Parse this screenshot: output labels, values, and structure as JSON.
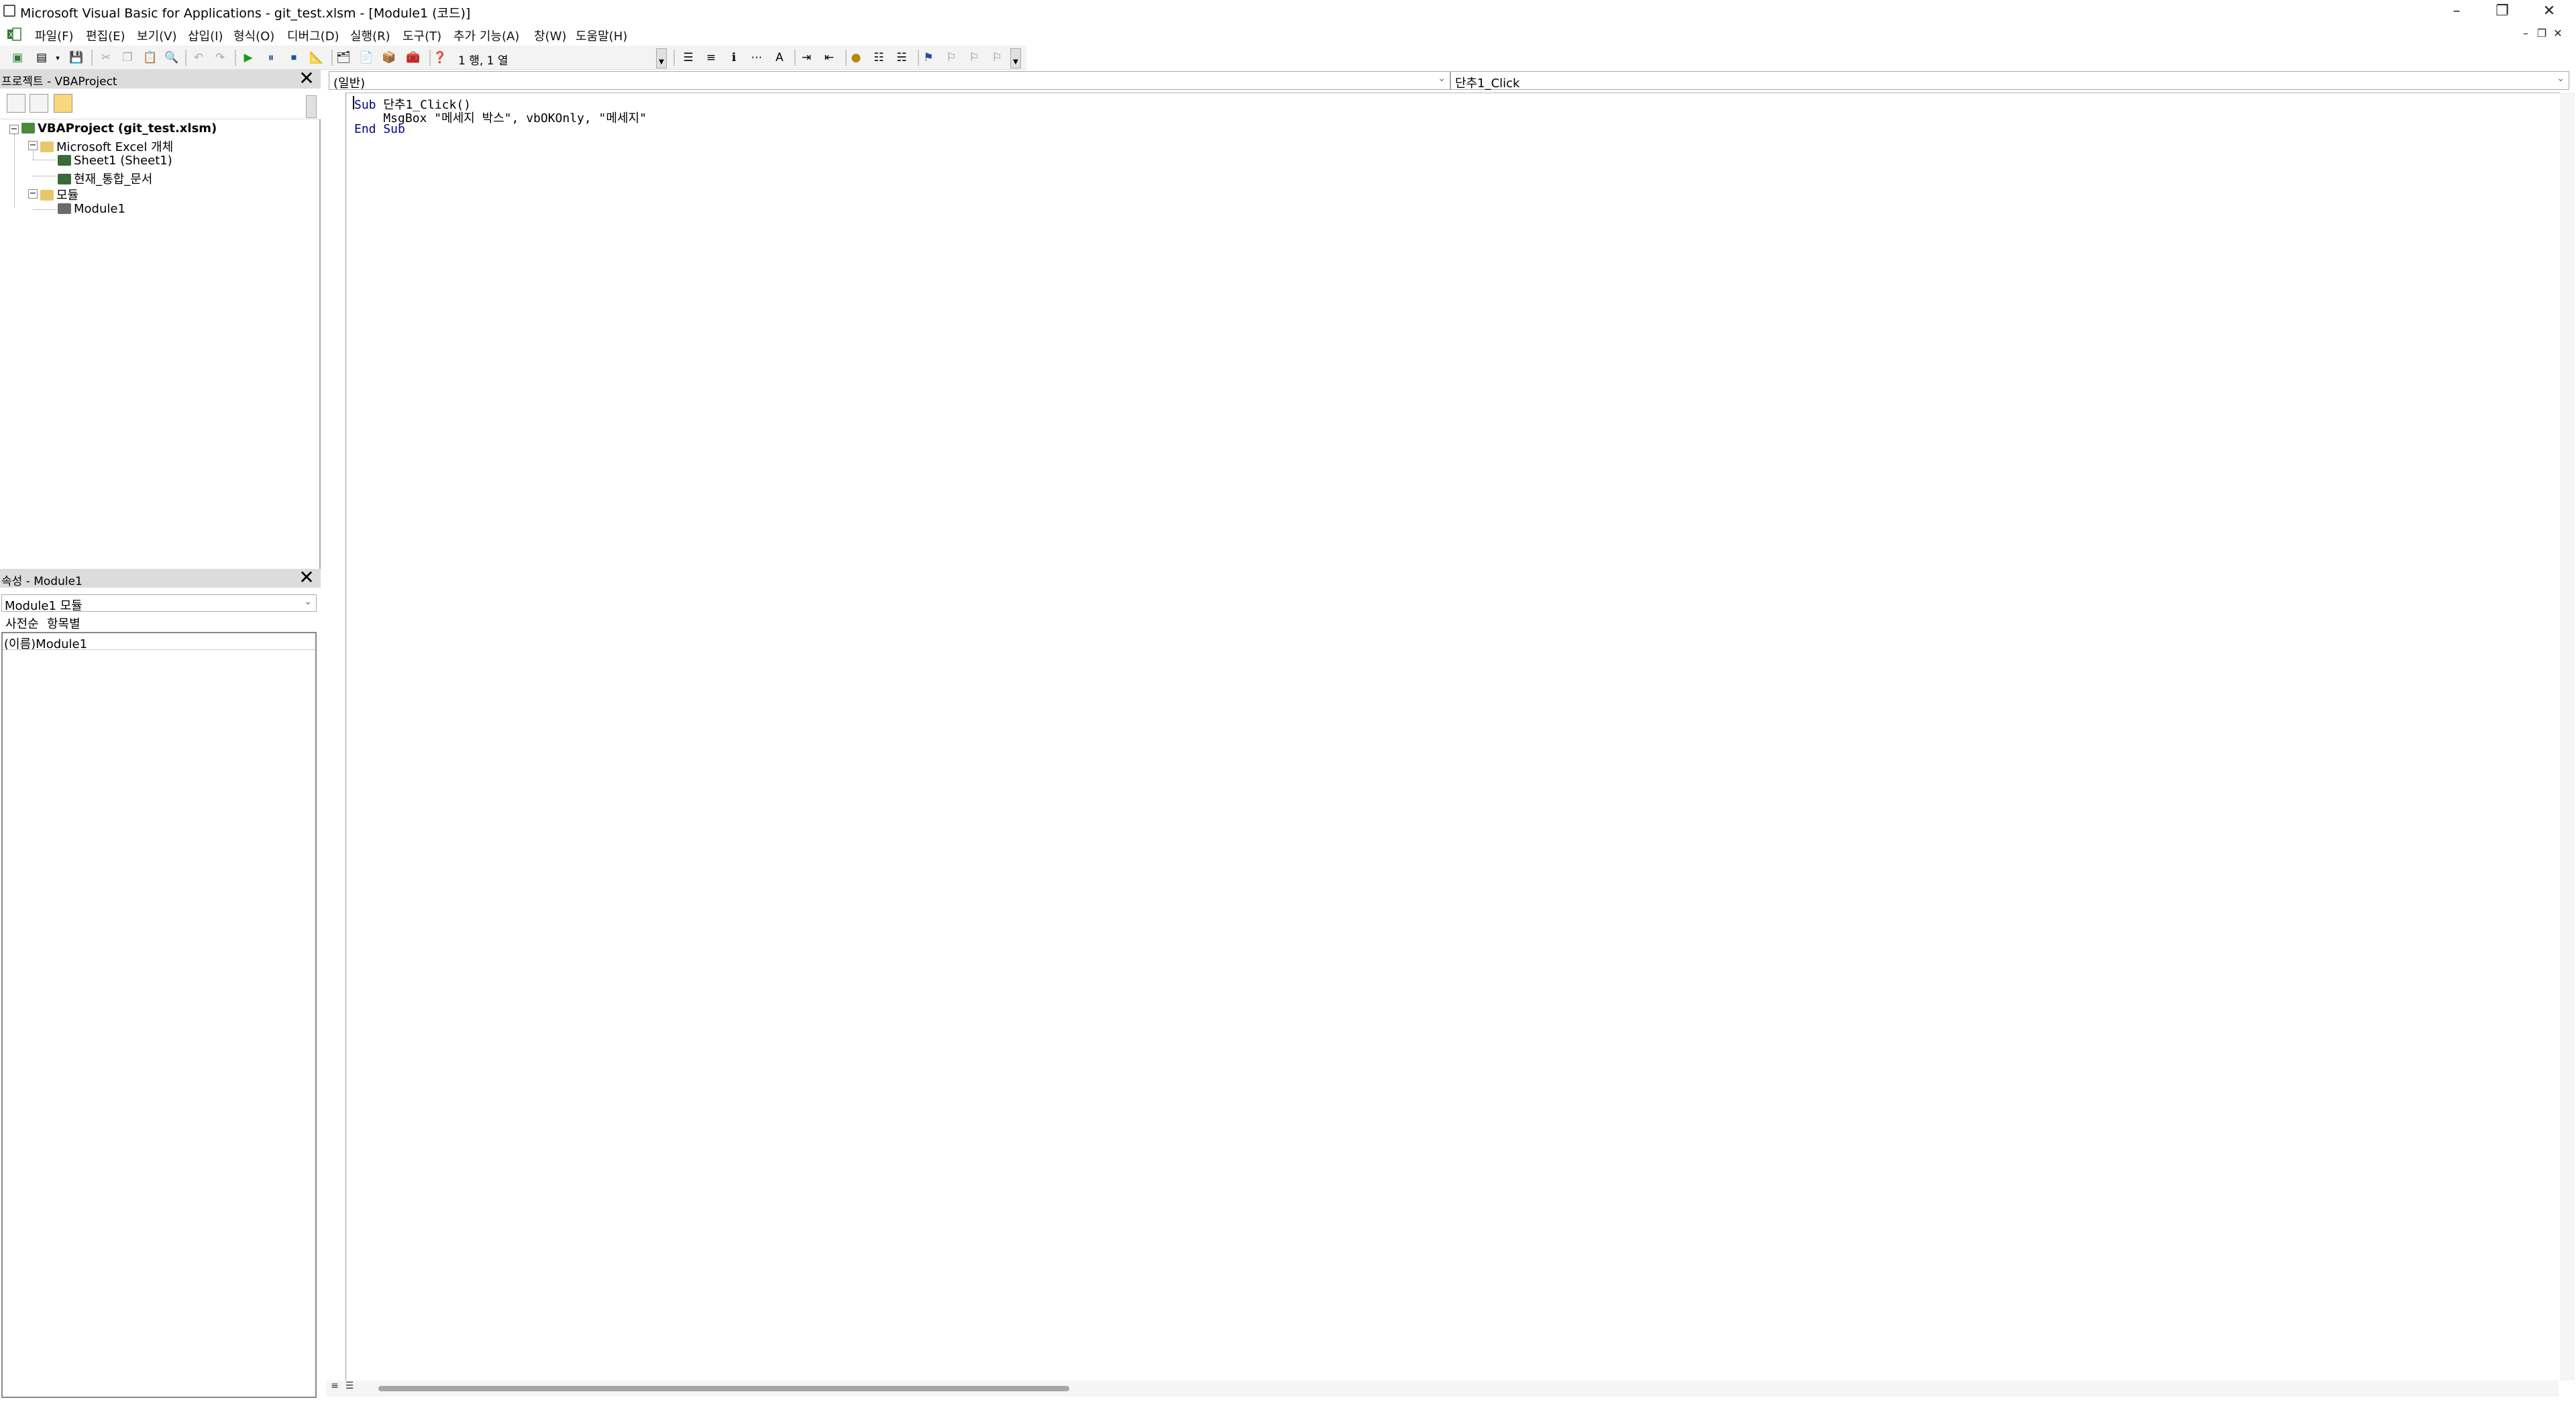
{
  "window": {
    "title": "Microsoft Visual Basic for Applications - git_test.xlsm - [Module1 (코드)]",
    "controls": [
      "–",
      "❐",
      "✕"
    ],
    "mdi_controls": [
      "–",
      "❐",
      "✕"
    ]
  },
  "menu": {
    "items": [
      "파일(F)",
      "편집(E)",
      "보기(V)",
      "삽입(I)",
      "형식(O)",
      "디버그(D)",
      "실행(R)",
      "도구(T)",
      "추가 기능(A)",
      "창(W)",
      "도움말(H)"
    ]
  },
  "toolbar": {
    "position": "1 행, 1 열"
  },
  "project": {
    "header": "프로젝트 - VBAProject",
    "tree": [
      {
        "label": "VBAProject (git_test.xlsm)",
        "bold": true
      },
      {
        "label": "Microsoft Excel 개체"
      },
      {
        "label": "Sheet1 (Sheet1)"
      },
      {
        "label": "현재_통합_문서"
      },
      {
        "label": "모듈"
      },
      {
        "label": "Module1"
      }
    ]
  },
  "properties": {
    "header": "속성 - Module1",
    "selected_object": "Module1 모듈",
    "tabs": [
      "사전순",
      "항목별"
    ],
    "rows": [
      {
        "name": "(이름)",
        "value": "Module1"
      }
    ]
  },
  "code": {
    "object_combo": "(일반)",
    "procedure_combo": "단추1_Click",
    "lines": [
      {
        "kw": "Sub",
        "rest": " 단추1_Click()"
      },
      {
        "kw": "",
        "rest": "    MsgBox \"메세지 박스\", vbOKOnly, \"메세지\""
      },
      {
        "kw": "End Sub",
        "rest": ""
      }
    ]
  }
}
